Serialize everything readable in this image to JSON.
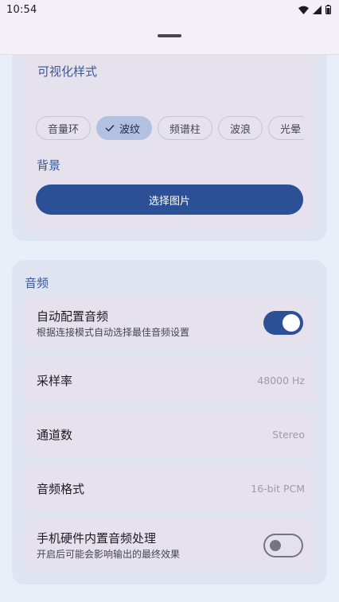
{
  "status_bar": {
    "time": "10:54",
    "icons": [
      "wifi-icon",
      "signal-icon",
      "battery-icon"
    ]
  },
  "visualization": {
    "title": "可视化样式",
    "chips": [
      {
        "label": "音量环",
        "selected": false
      },
      {
        "label": "波纹",
        "selected": true
      },
      {
        "label": "频谱柱",
        "selected": false
      },
      {
        "label": "波浪",
        "selected": false
      },
      {
        "label": "光晕",
        "selected": false
      }
    ]
  },
  "background": {
    "title": "背景",
    "button_label": "选择图片"
  },
  "audio": {
    "title": "音频",
    "auto_config": {
      "label": "自动配置音频",
      "description": "根据连接模式自动选择最佳音频设置",
      "enabled": true
    },
    "sample_rate": {
      "label": "采样率",
      "value": "48000 Hz"
    },
    "channels": {
      "label": "通道数",
      "value": "Stereo"
    },
    "format": {
      "label": "音频格式",
      "value": "16-bit PCM"
    },
    "hardware_processing": {
      "label": "手机硬件内置音频处理",
      "description": "开启后可能会影响输出的最终效果",
      "enabled": false
    }
  },
  "colors": {
    "primary": "#2b5096",
    "accent_text": "#3c5894",
    "chip_selected": "#b2c1e0",
    "page_background": "#e9eef9",
    "card_background": "#e0e4f1"
  }
}
